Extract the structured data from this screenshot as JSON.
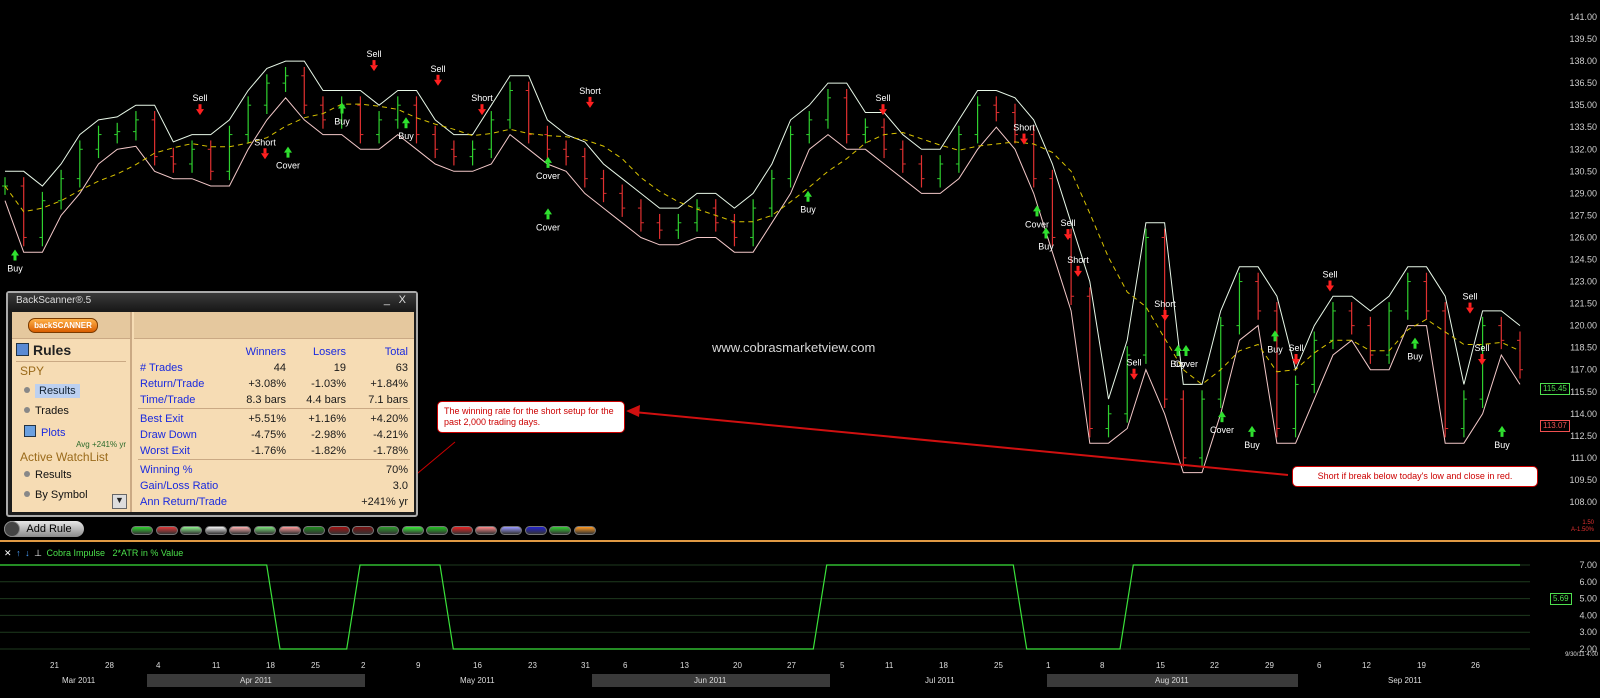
{
  "watermark": "www.cobrasmarketview.com",
  "callouts": {
    "winning": "The winning rate for the short setup for the past 2,000 trading days.",
    "short_rule": "Short if break below today's low and close in red."
  },
  "price_axis": [
    "141.00",
    "139.50",
    "138.00",
    "136.50",
    "135.00",
    "133.50",
    "132.00",
    "130.50",
    "129.00",
    "127.50",
    "126.00",
    "124.50",
    "123.00",
    "121.50",
    "120.00",
    "118.50",
    "117.00",
    "115.50",
    "114.00",
    "112.50",
    "111.00",
    "109.50",
    "108.00"
  ],
  "price_badges": {
    "upper": "115.45",
    "lower": "113.07"
  },
  "chart_data": {
    "type": "line",
    "title": "",
    "x": [
      "Mar 2011",
      "Apr 2011",
      "May 2011",
      "Jun 2011",
      "Jul 2011",
      "Aug 2011",
      "Sep 2011"
    ],
    "ylim": [
      108.0,
      141.0
    ],
    "series": [
      {
        "values": [
          129.5,
          126,
          128.5,
          130,
          132,
          133,
          133.2,
          134,
          131.5,
          131,
          132,
          130.5,
          133,
          135,
          136.5,
          137,
          135,
          134,
          135,
          133,
          134,
          135,
          133,
          132,
          131.5,
          132,
          134,
          136,
          133,
          132,
          131.5,
          130,
          129,
          128,
          127,
          126.5,
          127,
          128,
          127,
          126,
          128,
          130,
          133,
          134,
          135.5,
          133,
          133.5,
          132,
          131,
          130,
          131,
          133,
          135,
          134.5,
          133,
          130,
          126,
          122,
          113,
          114,
          118,
          126,
          115,
          111,
          115,
          120,
          123,
          121,
          113,
          116,
          119,
          121,
          120,
          118,
          121,
          123,
          121,
          113,
          115,
          120,
          119,
          117
        ]
      }
    ],
    "signals": [
      {
        "label": "Buy",
        "price": 124.5
      },
      {
        "label": "Sell",
        "price": 135.0
      },
      {
        "label": "Short",
        "price": 132.0
      },
      {
        "label": "Cover",
        "price": 131.5
      },
      {
        "label": "Buy",
        "price": 134.5
      },
      {
        "label": "Sell",
        "price": 138.0
      },
      {
        "label": "Buy",
        "price": 133.5
      },
      {
        "label": "Sell",
        "price": 137.0
      },
      {
        "label": "Short",
        "price": 135.0
      },
      {
        "label": "Cover",
        "price": 130.8
      },
      {
        "label": "Short",
        "price": 135.5
      },
      {
        "label": "Cover",
        "price": 127.3
      },
      {
        "label": "Buy",
        "price": 128.5
      },
      {
        "label": "Sell",
        "price": 135.0
      },
      {
        "label": "Short",
        "price": 133.0
      },
      {
        "label": "Cover",
        "price": 127.5
      },
      {
        "label": "Buy",
        "price": 126.0
      },
      {
        "label": "Sell",
        "price": 126.5
      },
      {
        "label": "Short",
        "price": 124.0
      },
      {
        "label": "Short",
        "price": 121.0
      },
      {
        "label": "Buy",
        "price": 118.0
      },
      {
        "label": "Cover",
        "price": 118.0
      },
      {
        "label": "Sell",
        "price": 117.0
      },
      {
        "label": "Cover",
        "price": 113.5
      },
      {
        "label": "Buy",
        "price": 112.5
      },
      {
        "label": "Sell",
        "price": 118.0
      },
      {
        "label": "Buy",
        "price": 119.0
      },
      {
        "label": "Sell",
        "price": 123.0
      },
      {
        "label": "Buy",
        "price": 118.5
      },
      {
        "label": "Sell",
        "price": 121.5
      },
      {
        "label": "Buy",
        "price": 112.5
      },
      {
        "label": "Sell",
        "price": 118.0
      }
    ]
  },
  "indicator": {
    "name": "Cobra Impulse",
    "desc": "2*ATR in % Value",
    "axis": [
      "7.00",
      "6.00",
      "5.00",
      "4.00",
      "3.00",
      "2.00"
    ],
    "badge": "5.69",
    "values": [
      7,
      7,
      7,
      7,
      7,
      7,
      7,
      7,
      7,
      7,
      7,
      7,
      7,
      7,
      7,
      7,
      7,
      7,
      7,
      7,
      7,
      2,
      2,
      2,
      2,
      2,
      2,
      7,
      7,
      7,
      7,
      7,
      7,
      7,
      2,
      2,
      2,
      2,
      2,
      2,
      2,
      2,
      2,
      2,
      2,
      2,
      2,
      2,
      2,
      2,
      2,
      2,
      2,
      2,
      2,
      2,
      2,
      2,
      2,
      2,
      2,
      2,
      7,
      7,
      7,
      7,
      7,
      7,
      7,
      7,
      7,
      7,
      7,
      7,
      7,
      7,
      7,
      2,
      2,
      2,
      2,
      2,
      2,
      2,
      2,
      7,
      7,
      7,
      7,
      7,
      7,
      7,
      7,
      7,
      7,
      7,
      7,
      7,
      7,
      7,
      7,
      7,
      7,
      7,
      7,
      7,
      7,
      7,
      7,
      7,
      7,
      7,
      7,
      7,
      7
    ]
  },
  "xaxis": {
    "days": [
      "21",
      "28",
      "4",
      "11",
      "18",
      "25",
      "2",
      "9",
      "16",
      "23",
      "31",
      "6",
      "13",
      "20",
      "27",
      "5",
      "11",
      "18",
      "25",
      "1",
      "8",
      "15",
      "22",
      "29",
      "6",
      "12",
      "19",
      "26"
    ],
    "months": [
      "Mar 2011",
      "Apr 2011",
      "May 2011",
      "Jun 2011",
      "Jul 2011",
      "Aug 2011",
      "Sep 2011"
    ],
    "timestamp": "9/30/11 4:00"
  },
  "panel": {
    "title": "BackScanner®.5",
    "logo": "backSCANNER",
    "rules": "Rules",
    "symbol": "SPY",
    "nav": [
      "Results",
      "Trades",
      "Plots"
    ],
    "avg": "Avg +241% yr",
    "watchlist": "Active WatchList",
    "watch_nav": [
      "Results",
      "By Symbol"
    ],
    "cols": [
      "Winners",
      "Losers",
      "Total"
    ],
    "rows": [
      {
        "label": "# Trades",
        "w": "44",
        "l": "19",
        "t": "63"
      },
      {
        "label": "Return/Trade",
        "w": "+3.08%",
        "l": "-1.03%",
        "t": "+1.84%"
      },
      {
        "label": "Time/Trade",
        "w": "8.3 bars",
        "l": "4.4 bars",
        "t": "7.1 bars"
      },
      {
        "label": "Best Exit",
        "w": "+5.51%",
        "l": "+1.16%",
        "t": "+4.20%"
      },
      {
        "label": "Draw Down",
        "w": "-4.75%",
        "l": "-2.98%",
        "t": "-4.21%"
      },
      {
        "label": "Worst Exit",
        "w": "-1.76%",
        "l": "-1.82%",
        "t": "-1.78%"
      },
      {
        "label": "Winning %",
        "w": "",
        "l": "",
        "t": "70%"
      },
      {
        "label": "Gain/Loss Ratio",
        "w": "",
        "l": "",
        "t": "3.0"
      },
      {
        "label": "Ann Return/Trade",
        "w": "",
        "l": "",
        "t": "+241% yr"
      }
    ]
  },
  "add_rule": "Add Rule",
  "pill_colors": [
    "#2fd02f",
    "#e03a3a",
    "#8ef08e",
    "#f0f0f0",
    "#ffb0b0",
    "#7ae07a",
    "#ff9a9a",
    "#1f8a1f",
    "#a01010",
    "#7a1010",
    "#2b9a2b",
    "#39e839",
    "#22c022",
    "#e82222",
    "#ff8888",
    "#9a9aff",
    "#2222cc",
    "#33cc33",
    "#ff9922"
  ],
  "corner_note": "1.50\nA-1.50%"
}
